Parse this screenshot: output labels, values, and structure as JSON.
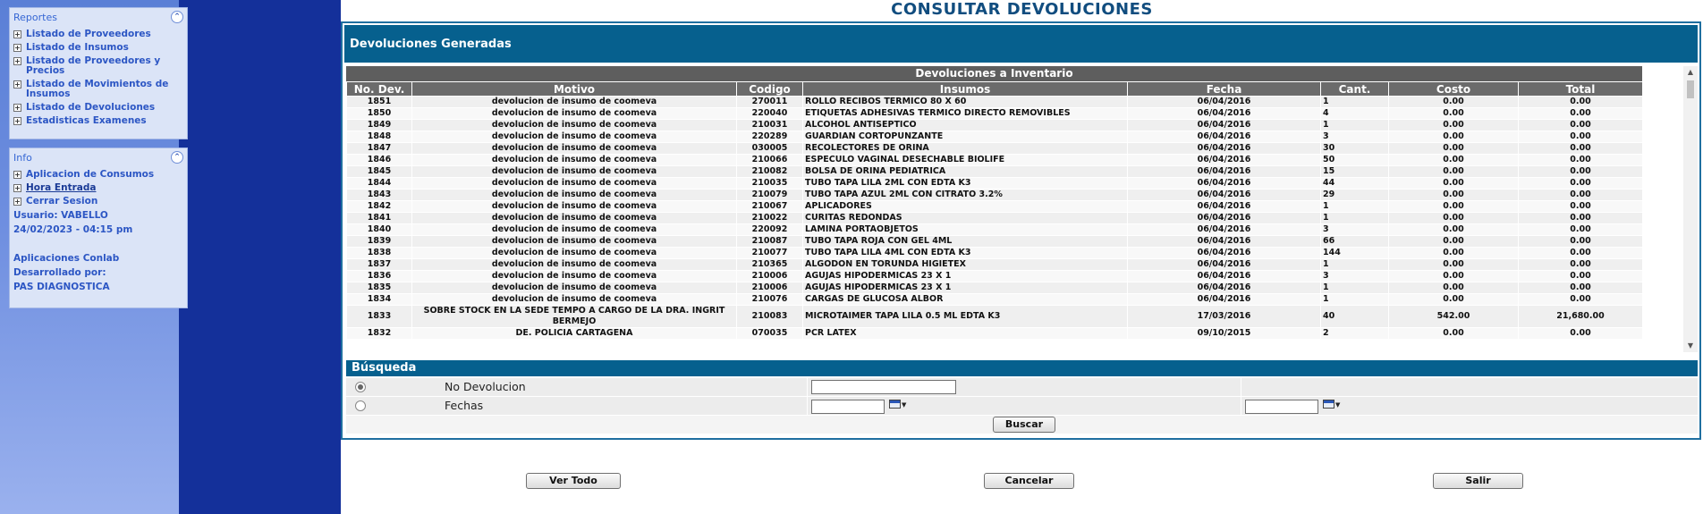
{
  "sidebar": {
    "reports_panel": {
      "title": "Reportes",
      "items": [
        {
          "label": "Listado de Proveedores"
        },
        {
          "label": "Listado de Insumos"
        },
        {
          "label": "Listado de Proveedores y Precios"
        },
        {
          "label": "Listado de Movimientos de Insumos"
        },
        {
          "label": "Listado de Devoluciones"
        },
        {
          "label": "Estadisticas Examenes"
        }
      ]
    },
    "info_panel": {
      "title": "Info",
      "items": [
        {
          "label": "Aplicacion de Consumos"
        },
        {
          "label": "Hora Entrada"
        },
        {
          "label": "Cerrar Sesion"
        }
      ],
      "user": "Usuario: VABELLO",
      "datetime": "24/02/2023 - 04:15 pm",
      "app_name": "Aplicaciones Conlab",
      "developed_by": "Desarrollado por:",
      "company": "PAS DIAGNOSTICA"
    }
  },
  "main": {
    "page_title": "CONSULTAR DEVOLUCIONES",
    "section_title": "Devoluciones Generadas",
    "grid": {
      "caption": "Devoluciones a Inventario",
      "columns": [
        "No. Dev.",
        "Motivo",
        "Codigo",
        "Insumos",
        "Fecha",
        "Cant.",
        "Costo",
        "Total"
      ],
      "rows": [
        [
          "1851",
          "devolucion de insumo de coomeva",
          "270011",
          "ROLLO RECIBOS TERMICO 80 X 60",
          "06/04/2016",
          "1",
          "0.00",
          "0.00"
        ],
        [
          "1850",
          "devolucion de insumo de coomeva",
          "220040",
          "ETIQUETAS ADHESIVAS TERMICO DIRECTO REMOVIBLES",
          "06/04/2016",
          "4",
          "0.00",
          "0.00"
        ],
        [
          "1849",
          "devolucion de insumo de coomeva",
          "210031",
          "ALCOHOL ANTISEPTICO",
          "06/04/2016",
          "1",
          "0.00",
          "0.00"
        ],
        [
          "1848",
          "devolucion de insumo de coomeva",
          "220289",
          "GUARDIAN CORTOPUNZANTE",
          "06/04/2016",
          "3",
          "0.00",
          "0.00"
        ],
        [
          "1847",
          "devolucion de insumo de coomeva",
          "030005",
          "RECOLECTORES DE ORINA",
          "06/04/2016",
          "30",
          "0.00",
          "0.00"
        ],
        [
          "1846",
          "devolucion de insumo de coomeva",
          "210066",
          "ESPECULO VAGINAL DESECHABLE BIOLIFE",
          "06/04/2016",
          "50",
          "0.00",
          "0.00"
        ],
        [
          "1845",
          "devolucion de insumo de coomeva",
          "210082",
          "BOLSA DE ORINA PEDIATRICA",
          "06/04/2016",
          "15",
          "0.00",
          "0.00"
        ],
        [
          "1844",
          "devolucion de insumo de coomeva",
          "210035",
          "TUBO TAPA LILA 2ML CON EDTA K3",
          "06/04/2016",
          "44",
          "0.00",
          "0.00"
        ],
        [
          "1843",
          "devolucion de insumo de coomeva",
          "210079",
          "TUBO TAPA AZUL 2ML CON CITRATO 3.2%",
          "06/04/2016",
          "29",
          "0.00",
          "0.00"
        ],
        [
          "1842",
          "devolucion de insumo de coomeva",
          "210067",
          "APLICADORES",
          "06/04/2016",
          "1",
          "0.00",
          "0.00"
        ],
        [
          "1841",
          "devolucion de insumo de coomeva",
          "210022",
          "CURITAS REDONDAS",
          "06/04/2016",
          "1",
          "0.00",
          "0.00"
        ],
        [
          "1840",
          "devolucion de insumo de coomeva",
          "220092",
          "LAMINA PORTAOBJETOS",
          "06/04/2016",
          "3",
          "0.00",
          "0.00"
        ],
        [
          "1839",
          "devolucion de insumo de coomeva",
          "210087",
          "TUBO TAPA ROJA CON GEL 4ML",
          "06/04/2016",
          "66",
          "0.00",
          "0.00"
        ],
        [
          "1838",
          "devolucion de insumo de coomeva",
          "210077",
          "TUBO TAPA LILA 4ML CON EDTA K3",
          "06/04/2016",
          "144",
          "0.00",
          "0.00"
        ],
        [
          "1837",
          "devolucion de insumo de coomeva",
          "210365",
          "ALGODON EN TORUNDA HIGIETEX",
          "06/04/2016",
          "1",
          "0.00",
          "0.00"
        ],
        [
          "1836",
          "devolucion de insumo de coomeva",
          "210006",
          "AGUJAS HIPODERMICAS 23 X 1",
          "06/04/2016",
          "3",
          "0.00",
          "0.00"
        ],
        [
          "1835",
          "devolucion de insumo de coomeva",
          "210006",
          "AGUJAS HIPODERMICAS 23 X 1",
          "06/04/2016",
          "1",
          "0.00",
          "0.00"
        ],
        [
          "1834",
          "devolucion de insumo de coomeva",
          "210076",
          "CARGAS DE GLUCOSA ALBOR",
          "06/04/2016",
          "1",
          "0.00",
          "0.00"
        ],
        [
          "1833",
          "SOBRE STOCK EN LA SEDE TEMPO A CARGO DE LA DRA. INGRIT BERMEJO",
          "210083",
          "MICROTAIMER TAPA LILA 0.5 ML EDTA K3",
          "17/03/2016",
          "40",
          "542.00",
          "21,680.00"
        ],
        [
          "1832",
          "DE. POLICIA CARTAGENA",
          "070035",
          "PCR LATEX",
          "09/10/2015",
          "2",
          "0.00",
          "0.00"
        ]
      ]
    },
    "search": {
      "title": "Búsqueda",
      "option_number_label": "No Devolucion",
      "option_dates_label": "Fechas",
      "number_value": "",
      "date_from_value": "",
      "date_to_value": "",
      "search_button": "Buscar",
      "selected_option": "No Devolucion"
    },
    "footer_buttons": {
      "view_all": "Ver Todo",
      "cancel": "Cancelar",
      "exit": "Salir"
    }
  },
  "colors": {
    "header_blue": "#06608e",
    "title_blue": "#114d7f",
    "dark_band": "#14309a",
    "grid_header_gray": "#6b6b6b"
  }
}
